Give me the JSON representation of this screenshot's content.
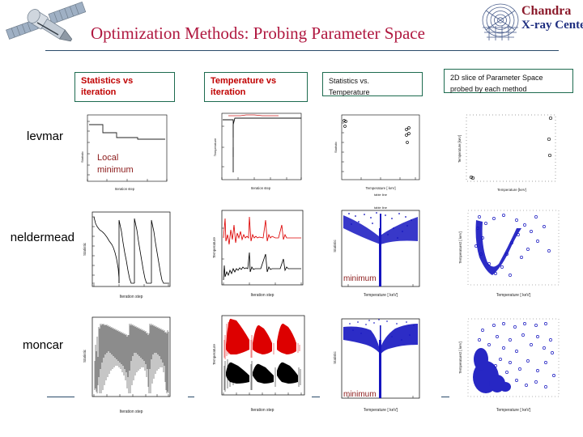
{
  "slide": {
    "title": "Optimization Methods: Probing Parameter Space",
    "title_color": "#b01840",
    "rule_color": "#2a4a6a",
    "background": "#ffffff"
  },
  "branding": {
    "satellite_icon": "chandra-satellite-icon",
    "observatory_mark": "chandra-rings-icon",
    "name_line1": "Chandra",
    "name_line2": "X-ray Center",
    "name_line1_color": "#8b1a2b",
    "name_line2_color": "#1f2f80"
  },
  "columns": [
    {
      "label": "Statistics vs\niteration",
      "style": "bold",
      "border_color": "#1d6b4f",
      "text_color": "#c00000"
    },
    {
      "label": "Temperature vs\niteration",
      "style": "bold",
      "border_color": "#1d6b4f",
      "text_color": "#c00000"
    },
    {
      "label": "Statistics  vs.\nTemperature",
      "style": "plain",
      "border_color": "#1d6b4f",
      "text_color": "#101010"
    },
    {
      "label": "2D slice of Parameter Space\nprobed by each method",
      "style": "plain",
      "border_color": "#1d6b4f",
      "text_color": "#101010"
    }
  ],
  "rows": [
    {
      "label": "levmar"
    },
    {
      "label": "neldermead"
    },
    {
      "label": "moncar"
    }
  ],
  "annotations": [
    {
      "name": "local-minimum-note",
      "text": "Local\nminimum",
      "color": "#8b1a1a"
    },
    {
      "name": "minimum-note-neldermead",
      "text": "minimum",
      "color": "#8b1a1a"
    },
    {
      "name": "minimum-note-moncar",
      "text": "minimum",
      "color": "#8b1a1a"
    }
  ],
  "chart_data": [
    {
      "id": "levmar-stat-vs-iter",
      "type": "line",
      "title": "",
      "xlabel": "Iteration step",
      "ylabel": "Statistic",
      "xlim": [
        0,
        40
      ],
      "ylim": [
        1,
        100
      ],
      "yscale": "log",
      "grid": false,
      "series": [
        {
          "name": "statistic",
          "color": "#000000",
          "x": [
            0,
            5,
            6,
            11,
            12,
            17,
            18,
            40
          ],
          "y": [
            55,
            55,
            36,
            36,
            26,
            26,
            22,
            22
          ]
        }
      ]
    },
    {
      "id": "levmar-temp-vs-iter",
      "type": "line",
      "title": "",
      "xlabel": "Iteration step",
      "ylabel": "Temperature",
      "xlim": [
        0,
        40
      ],
      "ylim": [
        0.1,
        10
      ],
      "yscale": "log",
      "grid": false,
      "series": [
        {
          "name": "temperature",
          "color": "#000000",
          "x": [
            0,
            4,
            5,
            6,
            7,
            40
          ],
          "y": [
            5.6,
            5.6,
            0.2,
            1.4,
            5.5,
            5.5
          ]
        },
        {
          "name": "temperature-alt",
          "color": "#cc2020",
          "x": [
            5,
            9,
            14,
            20,
            26,
            33
          ],
          "y": [
            6.1,
            6.1,
            6.0,
            6.0,
            6.0,
            6.0
          ]
        }
      ]
    },
    {
      "id": "levmar-stat-vs-temp",
      "type": "scatter",
      "title": "table line",
      "xlabel": "Temperature [ keV]",
      "ylabel": "Statistic",
      "xlim": [
        0.1,
        10
      ],
      "ylim": [
        1,
        100000
      ],
      "xscale": "log",
      "yscale": "log",
      "grid": false,
      "points_color": "#000000",
      "n_points": 9
    },
    {
      "id": "levmar-param-slice",
      "type": "scatter",
      "title": "",
      "xlabel": "Temperature  [keV]",
      "ylabel": "Temperature  [keV]",
      "xlim": [
        0.1,
        10
      ],
      "ylim": [
        0.1,
        10
      ],
      "xscale": "log",
      "yscale": "log",
      "grid": false,
      "points_color": "#1515c0",
      "n_points": 6
    },
    {
      "id": "neldermead-stat-vs-iter",
      "type": "line",
      "title": "",
      "xlabel": "Iteration step",
      "ylabel": "Statistic",
      "xlim": [
        0,
        1500
      ],
      "ylim": [
        10,
        1000000
      ],
      "yscale": "log",
      "grid": false,
      "xticks": [
        0,
        500,
        1000,
        1500
      ],
      "series": [
        {
          "name": "statistic",
          "color": "#000000",
          "restarts": 4
        }
      ]
    },
    {
      "id": "neldermead-temp-vs-iter",
      "type": "line",
      "title": "",
      "xlabel": "Iteration step",
      "ylabel": "Temperature",
      "xlim": [
        0,
        1500
      ],
      "ylim": [
        0.1,
        10
      ],
      "yscale": "log",
      "grid": false,
      "xticks": [
        0,
        500,
        1000,
        1500
      ],
      "series": [
        {
          "name": "temperature-upper",
          "color": "#dd0000"
        },
        {
          "name": "temperature-lower",
          "color": "#000000"
        }
      ]
    },
    {
      "id": "neldermead-stat-vs-temp",
      "type": "scatter",
      "title": "table line",
      "xlabel": "Temperature [ keV]",
      "ylabel": "Statistic",
      "xlim": [
        0.1,
        10
      ],
      "ylim": [
        1,
        1000000
      ],
      "xscale": "log",
      "yscale": "log",
      "grid": false,
      "points_color": "#1515c0",
      "n_points": 1400,
      "minimum_at_x": 1.0
    },
    {
      "id": "neldermead-param-slice",
      "type": "scatter",
      "title": "",
      "xlabel": "Temperature [ keV]",
      "ylabel": "Temperature2 [ keV]",
      "xlim": [
        0.1,
        10
      ],
      "ylim": [
        0.1,
        10
      ],
      "xscale": "log",
      "yscale": "log",
      "grid": false,
      "points_color": "#1515c0",
      "n_points": 1200
    },
    {
      "id": "moncar-stat-vs-iter",
      "type": "line",
      "title": "",
      "xlabel": "Iteration step",
      "ylabel": "Statistic",
      "xlim": [
        0,
        2500
      ],
      "ylim": [
        0.1,
        1000000
      ],
      "yscale": "log",
      "grid": false,
      "xticks": [
        0,
        500,
        1000,
        1500,
        2000,
        2500
      ],
      "series": [
        {
          "name": "statistic",
          "color": "#000000",
          "restarts": 3
        }
      ]
    },
    {
      "id": "moncar-temp-vs-iter",
      "type": "line",
      "title": "",
      "xlabel": "Iteration step",
      "ylabel": "Temperature",
      "xlim": [
        0,
        1200
      ],
      "ylim": [
        0.1,
        10
      ],
      "yscale": "log",
      "grid": false,
      "xticks": [
        0,
        200,
        400,
        600,
        800,
        1000,
        1200
      ],
      "series": [
        {
          "name": "temperature-upper",
          "color": "#dd0000"
        },
        {
          "name": "temperature-lower",
          "color": "#000000"
        }
      ]
    },
    {
      "id": "moncar-stat-vs-temp",
      "type": "scatter",
      "title": "",
      "xlabel": "Temperature [ keV]",
      "ylabel": "Statistic",
      "xlim": [
        0.1,
        10
      ],
      "ylim": [
        0.01,
        1000000
      ],
      "xscale": "log",
      "yscale": "log",
      "grid": false,
      "points_color": "#1515c0",
      "n_points": 6000,
      "minimum_at_x": 1.0
    },
    {
      "id": "moncar-param-slice",
      "type": "scatter",
      "title": "",
      "xlabel": "Temperature [ keV]",
      "ylabel": "Temperature2 [ keV]",
      "xlim": [
        0.1,
        10
      ],
      "ylim": [
        0.1,
        10
      ],
      "xscale": "log",
      "yscale": "log",
      "grid": false,
      "points_color": "#1515c0",
      "n_points": 5000
    }
  ]
}
